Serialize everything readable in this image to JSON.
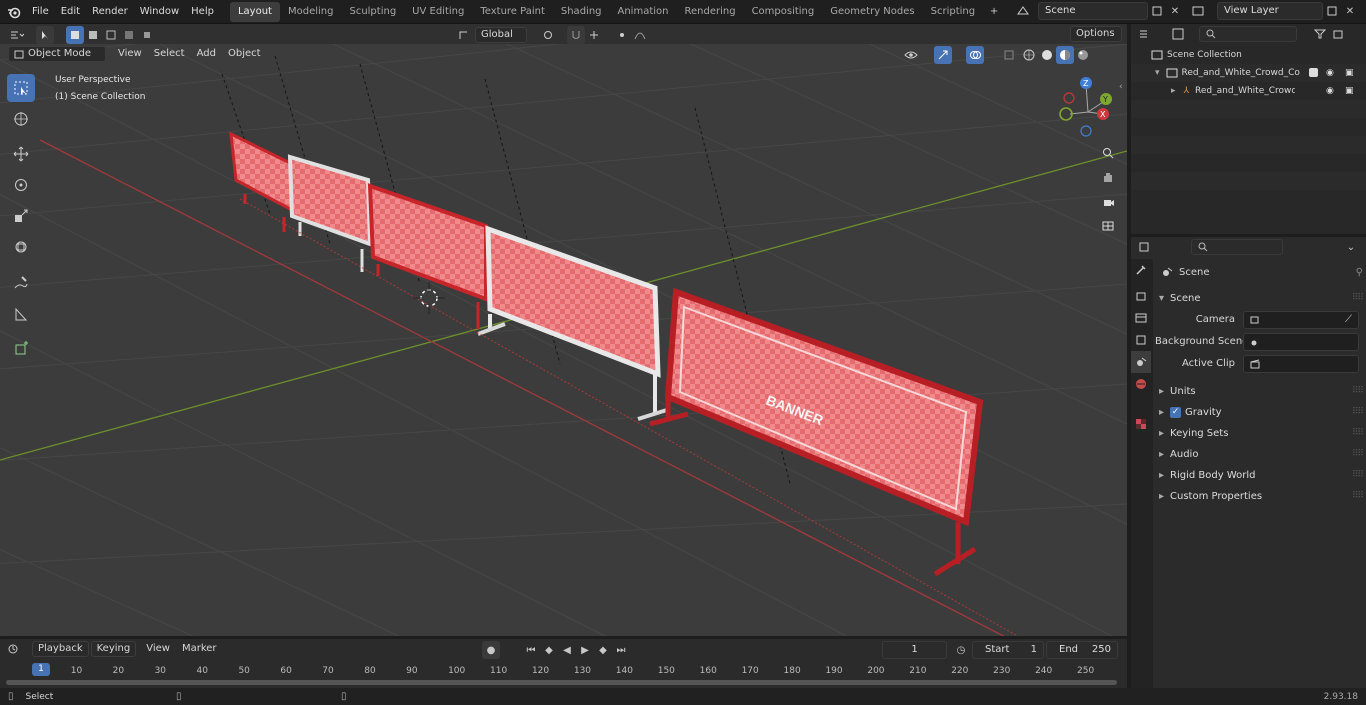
{
  "menu": {
    "file": "File",
    "edit": "Edit",
    "render": "Render",
    "window": "Window",
    "help": "Help"
  },
  "workspaces": [
    "Layout",
    "Modeling",
    "Sculpting",
    "UV Editing",
    "Texture Paint",
    "Shading",
    "Animation",
    "Rendering",
    "Compositing",
    "Geometry Nodes",
    "Scripting"
  ],
  "active_workspace": "Layout",
  "scene_field": "Scene",
  "view_layer_field": "View Layer",
  "toolbar": {
    "orientation": "Global",
    "options": "Options"
  },
  "viewport_header": {
    "mode": "Object Mode",
    "view": "View",
    "select": "Select",
    "add": "Add",
    "object": "Object"
  },
  "viewport": {
    "perspective": "User Perspective",
    "collection": "(1) Scene Collection",
    "banner_text": "BANNER"
  },
  "gizmo": {
    "x": "X",
    "y": "Y",
    "z": "Z"
  },
  "outliner": {
    "search_placeholder": "",
    "root": "Scene Collection",
    "collection": "Red_and_White_Crowd_Contr",
    "object": "Red_and_White_Crowd_C"
  },
  "properties": {
    "context": "Scene",
    "panel": "Scene",
    "camera_label": "Camera",
    "background_label": "Background Scene",
    "clip_label": "Active Clip",
    "subpanels": [
      "Units",
      "Gravity",
      "Keying Sets",
      "Audio",
      "Rigid Body World",
      "Custom Properties"
    ],
    "gravity_checked": true
  },
  "timeline": {
    "playback": "Playback",
    "keying": "Keying",
    "view": "View",
    "marker": "Marker",
    "current_frame": "1",
    "start_label": "Start",
    "start": "1",
    "end_label": "End",
    "end": "250",
    "ticks": [
      "1",
      "10",
      "20",
      "30",
      "40",
      "50",
      "60",
      "70",
      "80",
      "90",
      "100",
      "110",
      "120",
      "130",
      "140",
      "150",
      "160",
      "170",
      "180",
      "190",
      "200",
      "210",
      "220",
      "230",
      "240",
      "250"
    ]
  },
  "status": {
    "select": "Select",
    "version": "2.93.18"
  },
  "colors": {
    "accent": "#4772b3",
    "x_axis": "#c33a3a",
    "y_axis": "#7ea82e",
    "z_axis": "#3f7fd6",
    "grid_bg": "#3c3c3c"
  }
}
